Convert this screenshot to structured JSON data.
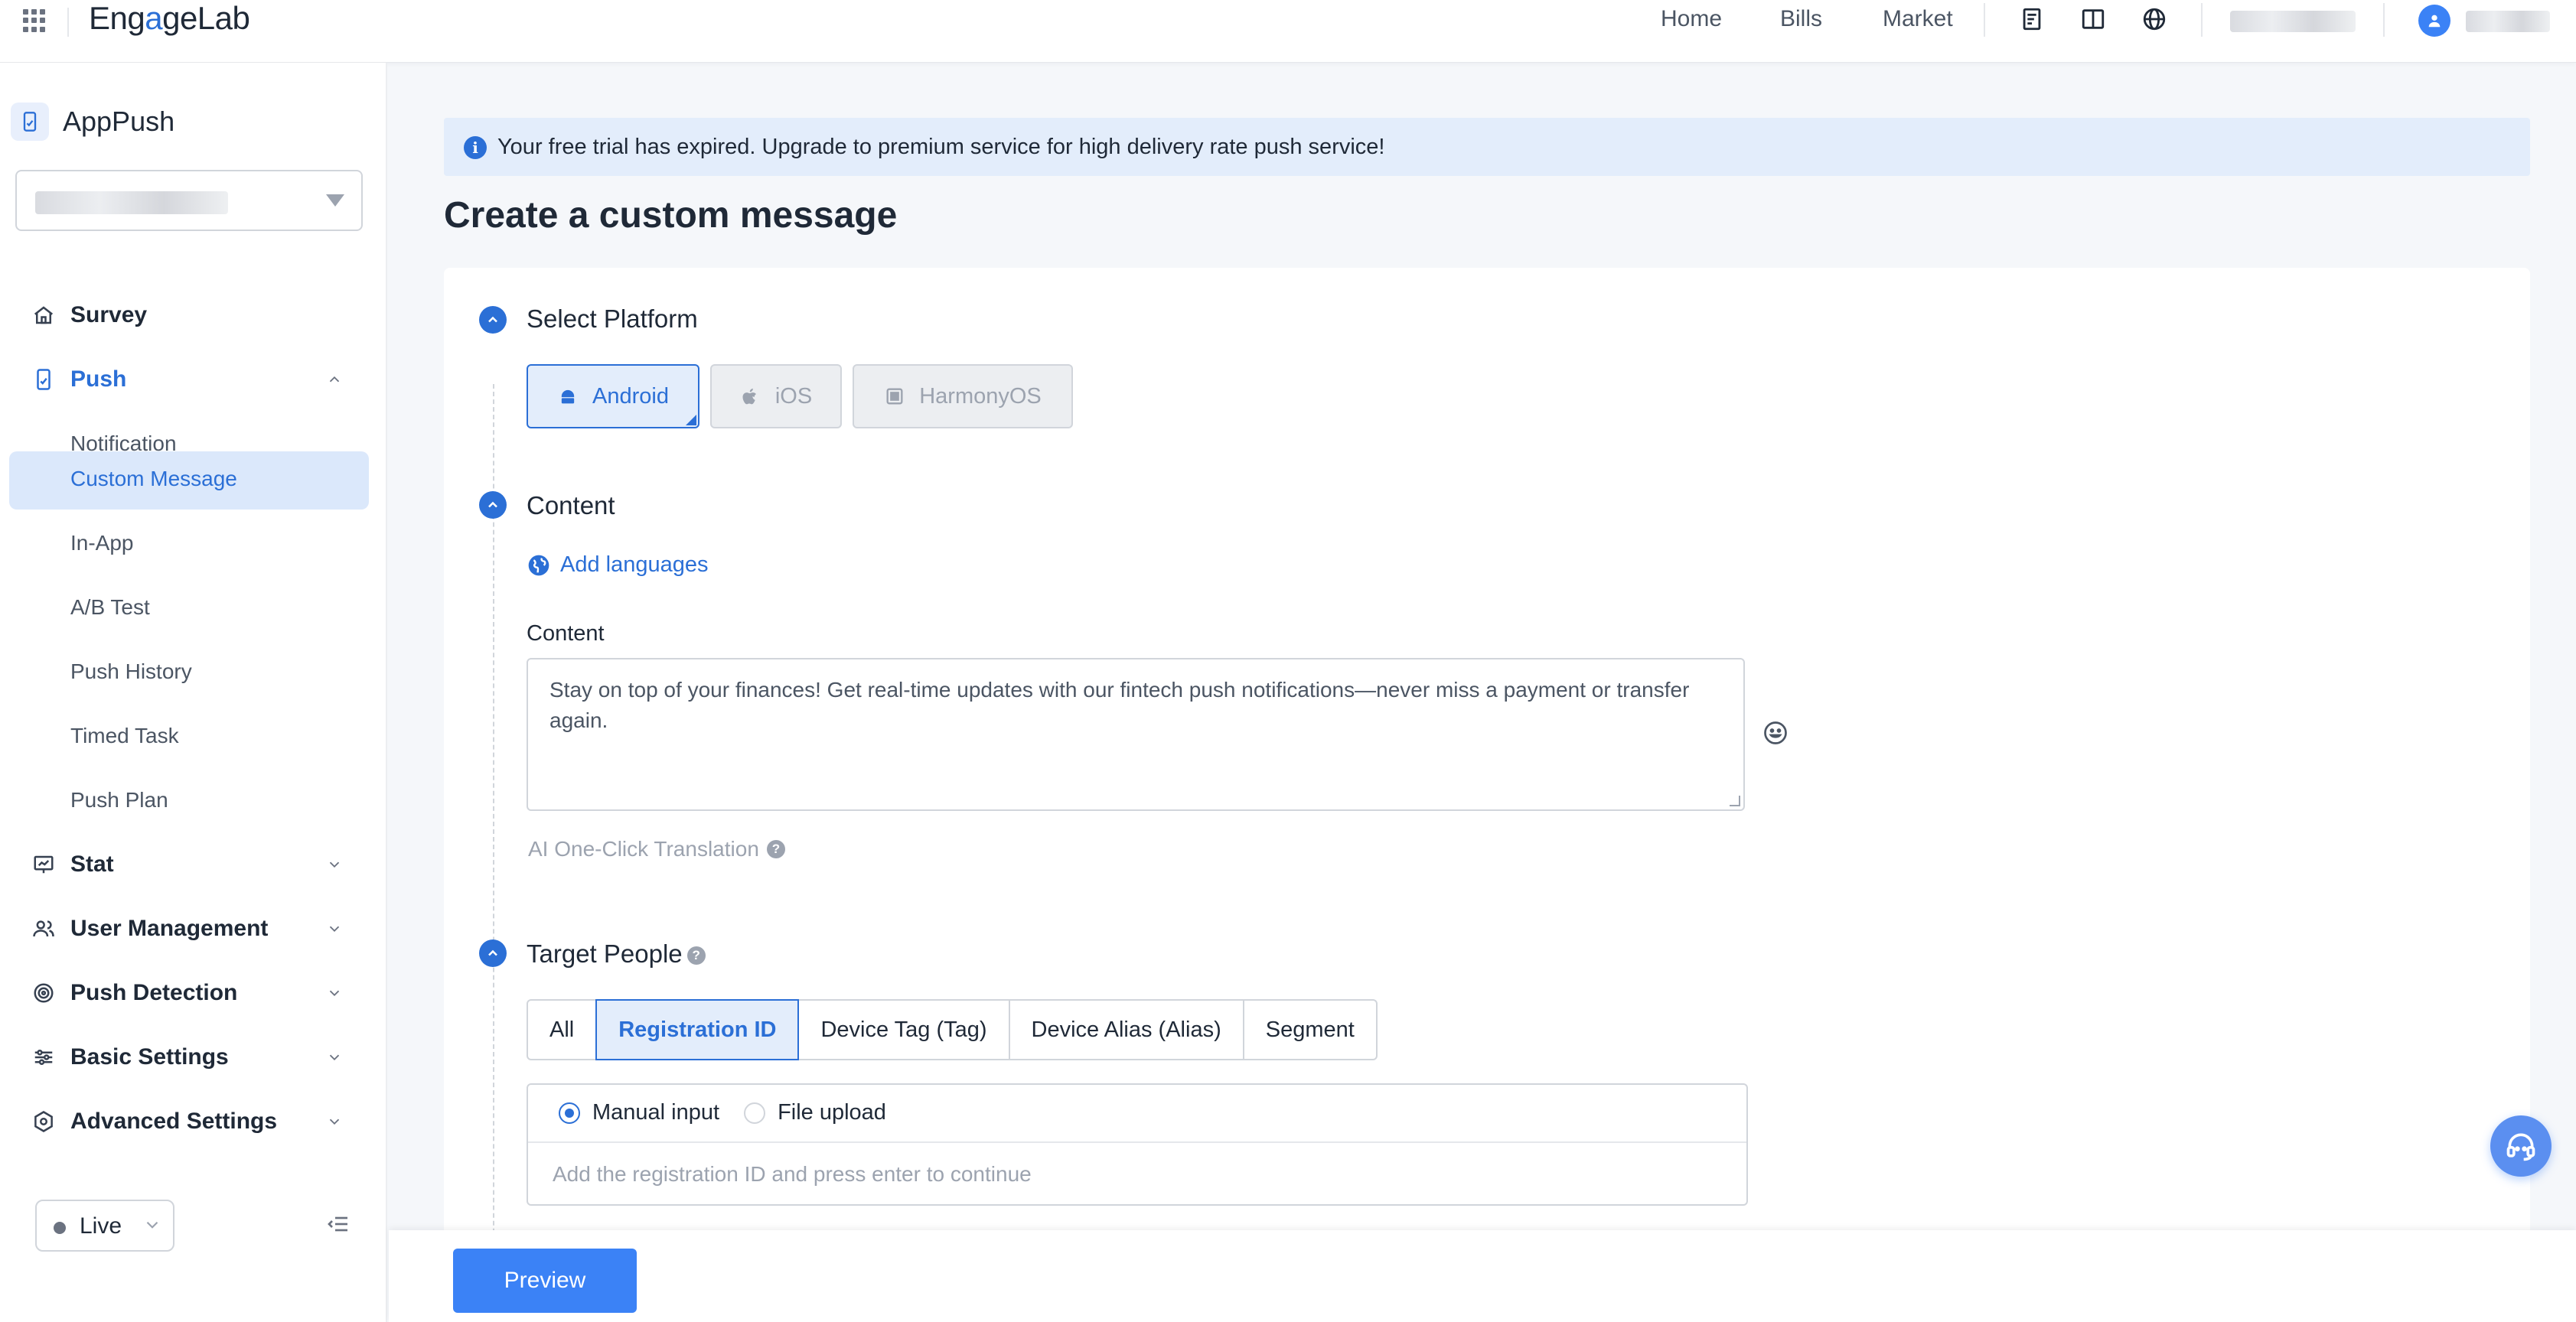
{
  "header": {
    "logo_text_start": "Eng",
    "logo_text_mid": "a",
    "logo_text_end": "geLab",
    "nav": [
      "Home",
      "Bills",
      "Market"
    ],
    "icons": [
      "document-icon",
      "book-icon",
      "globe-icon"
    ]
  },
  "sidebar": {
    "app_title": "AppPush",
    "menu": {
      "survey": "Survey",
      "push": "Push",
      "stat": "Stat",
      "user_management": "User Management",
      "push_detection": "Push Detection",
      "basic_settings": "Basic Settings",
      "advanced_settings": "Advanced Settings"
    },
    "push_sub": [
      "Notification",
      "Custom Message",
      "In-App",
      "A/B Test",
      "Push History",
      "Timed Task",
      "Push Plan"
    ],
    "selected_sub": "Custom Message",
    "env_label": "Live"
  },
  "main": {
    "banner": "Your free trial has expired. Upgrade to premium service for high delivery rate push service!",
    "page_title": "Create a custom message",
    "select_platform": {
      "title": "Select Platform",
      "platforms": [
        "Android",
        "iOS",
        "HarmonyOS"
      ],
      "selected": "Android"
    },
    "content": {
      "title": "Content",
      "add_languages": "Add languages",
      "field_label": "Content",
      "value": "Stay on top of your finances! Get real-time updates with our fintech push notifications—never miss a payment or transfer again.",
      "ai_translation": "AI One-Click Translation"
    },
    "target_people": {
      "title": "Target People",
      "tabs": [
        "All",
        "Registration ID",
        "Device Tag (Tag)",
        "Device Alias (Alias)",
        "Segment"
      ],
      "selected_tab": "Registration ID",
      "input_modes": [
        "Manual input",
        "File upload"
      ],
      "selected_mode": "Manual input",
      "placeholder": "Add the registration ID and press enter to continue"
    }
  },
  "footer": {
    "preview_label": "Preview"
  },
  "colors": {
    "accent": "#2b6fd6",
    "banner_bg": "#e3edfb",
    "selected_bg": "#dbe8fb"
  }
}
